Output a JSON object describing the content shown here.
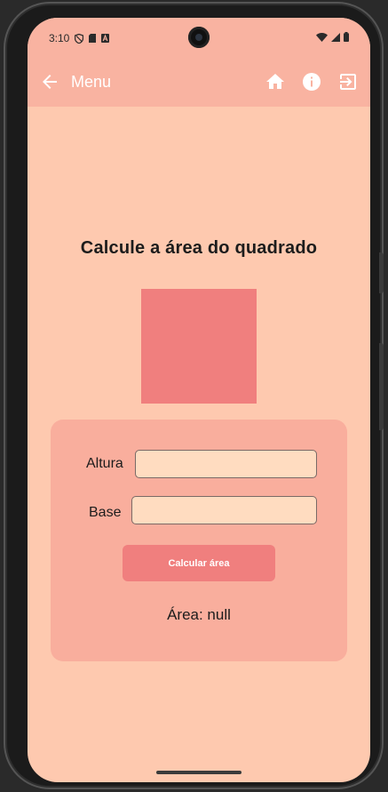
{
  "status_bar": {
    "time": "3:10",
    "left_icons": [
      "shield-icon",
      "sd-card-icon",
      "a-badge-icon"
    ],
    "right_icons": [
      "wifi-icon",
      "signal-icon",
      "battery-icon"
    ]
  },
  "app_bar": {
    "title": "Menu",
    "back_icon": "arrow-left-icon",
    "actions": [
      {
        "name": "home",
        "icon": "home-icon"
      },
      {
        "name": "info",
        "icon": "info-icon"
      },
      {
        "name": "exit",
        "icon": "exit-to-app-icon"
      }
    ]
  },
  "main": {
    "title": "Calcule a área do quadrado",
    "form": {
      "height_label": "Altura",
      "height_value": "",
      "base_label": "Base",
      "base_value": "",
      "button_label": "Calcular área",
      "result": "Área: null"
    }
  },
  "colors": {
    "background": "#fec9af",
    "app_bar": "#f9b3a1",
    "card": "#f9ae9d",
    "accent": "#f07f7e",
    "input_fill": "#ffdcc0"
  }
}
